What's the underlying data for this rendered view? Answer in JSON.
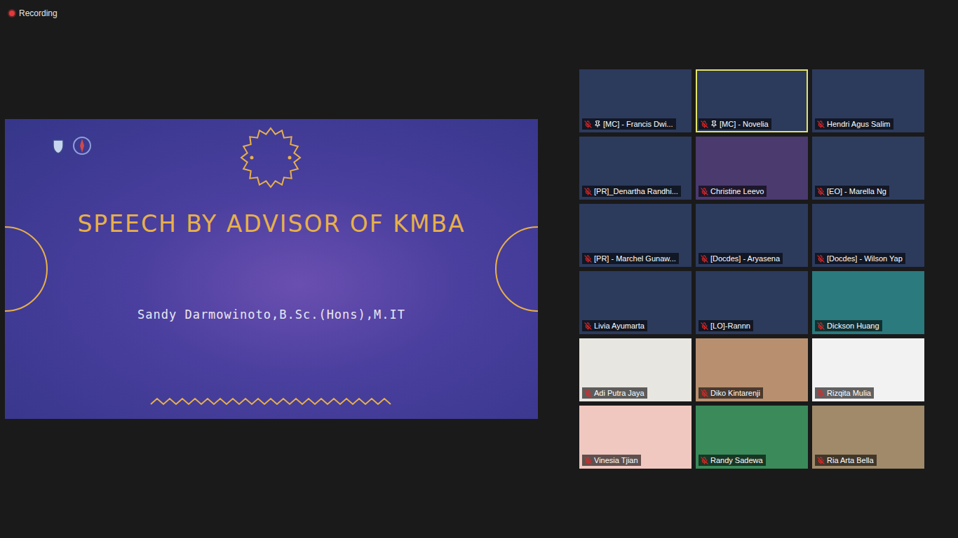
{
  "recording": {
    "label": "Recording",
    "on": true
  },
  "shared_screen": {
    "title": "SPEECH BY ADVISOR OF KMBA",
    "speaker": "Sandy Darmowinoto,B.Sc.(Hons),M.IT"
  },
  "participants": [
    {
      "name": "[MC] - Francis Dwi...",
      "muted": true,
      "pinned": true,
      "active_speaker": false,
      "color": "#2c3a5c"
    },
    {
      "name": "[MC] - Novelia",
      "muted": true,
      "pinned": true,
      "active_speaker": true,
      "color": "#2c3a5c"
    },
    {
      "name": "Hendri Agus Salim",
      "muted": true,
      "pinned": false,
      "active_speaker": false,
      "color": "#2c3a5c"
    },
    {
      "name": "[PR]_Denartha Randhi...",
      "muted": true,
      "pinned": false,
      "active_speaker": false,
      "color": "#2c3a5c"
    },
    {
      "name": "Christine Leevo",
      "muted": true,
      "pinned": false,
      "active_speaker": false,
      "color": "#4a3a6e"
    },
    {
      "name": "[EO] - Marella Ng",
      "muted": true,
      "pinned": false,
      "active_speaker": false,
      "color": "#2e3d5e"
    },
    {
      "name": "[PR] - Marchel Gunaw...",
      "muted": true,
      "pinned": false,
      "active_speaker": false,
      "color": "#2c3a5c"
    },
    {
      "name": "[Docdes] - Aryasena",
      "muted": true,
      "pinned": false,
      "active_speaker": false,
      "color": "#2c3a5c"
    },
    {
      "name": "[Docdes] - Wilson Yap",
      "muted": true,
      "pinned": false,
      "active_speaker": false,
      "color": "#2c3a5c"
    },
    {
      "name": "Livia Ayumarta",
      "muted": true,
      "pinned": false,
      "active_speaker": false,
      "color": "#2c3a5c"
    },
    {
      "name": "[LO]-Rannn",
      "muted": true,
      "pinned": false,
      "active_speaker": false,
      "color": "#2c3a5c"
    },
    {
      "name": "Dickson Huang",
      "muted": true,
      "pinned": false,
      "active_speaker": false,
      "color": "#2a7a7e"
    },
    {
      "name": "Adi Putra Jaya",
      "muted": true,
      "pinned": false,
      "active_speaker": false,
      "color": "#e8e6e0"
    },
    {
      "name": "Diko Kintarenji",
      "muted": true,
      "pinned": false,
      "active_speaker": false,
      "color": "#b89070"
    },
    {
      "name": "Rizqita Mulia",
      "muted": true,
      "pinned": false,
      "active_speaker": false,
      "color": "#f2f2f2"
    },
    {
      "name": "Vinesia Tjian",
      "muted": true,
      "pinned": false,
      "active_speaker": false,
      "color": "#f0c8c0"
    },
    {
      "name": "Randy Sadewa",
      "muted": true,
      "pinned": false,
      "active_speaker": false,
      "color": "#3a8a5a"
    },
    {
      "name": "Ria Arta Bella",
      "muted": true,
      "pinned": false,
      "active_speaker": false,
      "color": "#a08a6a"
    }
  ]
}
